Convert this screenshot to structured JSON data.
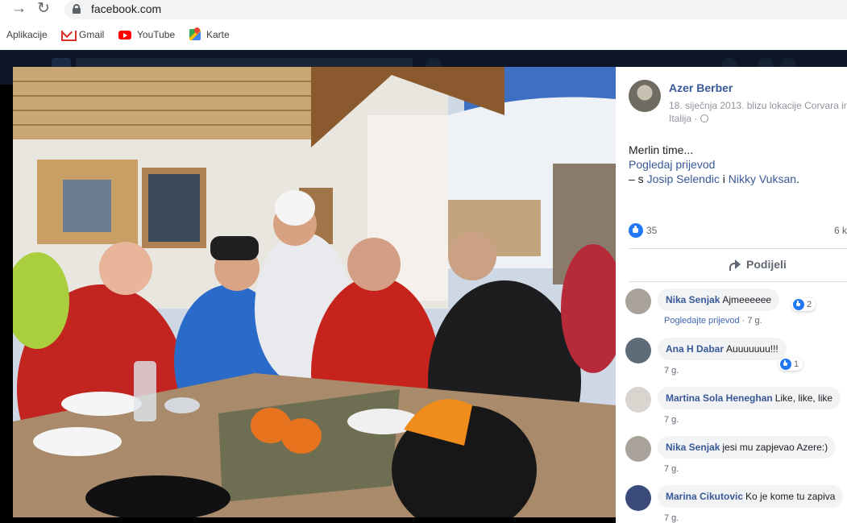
{
  "browser": {
    "url": "facebook.com",
    "bookmarks": [
      {
        "label": "Aplikacije",
        "icon": "apps-icon"
      },
      {
        "label": "Gmail",
        "icon": "gmail-icon"
      },
      {
        "label": "YouTube",
        "icon": "youtube-icon"
      },
      {
        "label": "Karte",
        "icon": "maps-icon"
      }
    ]
  },
  "post": {
    "author": "Azer Berber",
    "meta_line1": "18. siječnja 2013. blizu lokacije Corvara in",
    "meta_line2": "Italija ·",
    "text": "Merlin time...",
    "translate_link": "Pogledaj prijevod",
    "tagged_prefix": "– s ",
    "tagged_person1": "Josip Selendic",
    "tagged_and": " i ",
    "tagged_person2": "Nikky Vuksan",
    "tagged_suffix": ".",
    "like_count": "35",
    "comment_count_partial": "6 k",
    "share_label": "Podijeli"
  },
  "comments": [
    {
      "name": "Nika Senjak",
      "text": "Ajmeeeeee",
      "reactions": "2",
      "actions_link": "Pogledajte prijevod",
      "time": " · 7 g."
    },
    {
      "name": "Ana H Dabar",
      "text": "Auuuuuuu!!!",
      "reactions": "1",
      "actions_link": "",
      "time": "7 g."
    },
    {
      "name": "Martina Sola Heneghan",
      "text": "Like, like, like",
      "reactions": "",
      "actions_link": "",
      "time": "7 g."
    },
    {
      "name": "Nika Senjak",
      "text": "jesi mu zapjevao Azere:)",
      "reactions": "",
      "actions_link": "",
      "time": "7 g."
    },
    {
      "name": "Marina Cikutovic",
      "text": "Ko je kome tu zapiva",
      "reactions": "",
      "actions_link": "",
      "time": "7 g."
    }
  ],
  "colors": {
    "link": "#385898",
    "like_blue": "#2078f4",
    "backdrop": "#000000"
  }
}
